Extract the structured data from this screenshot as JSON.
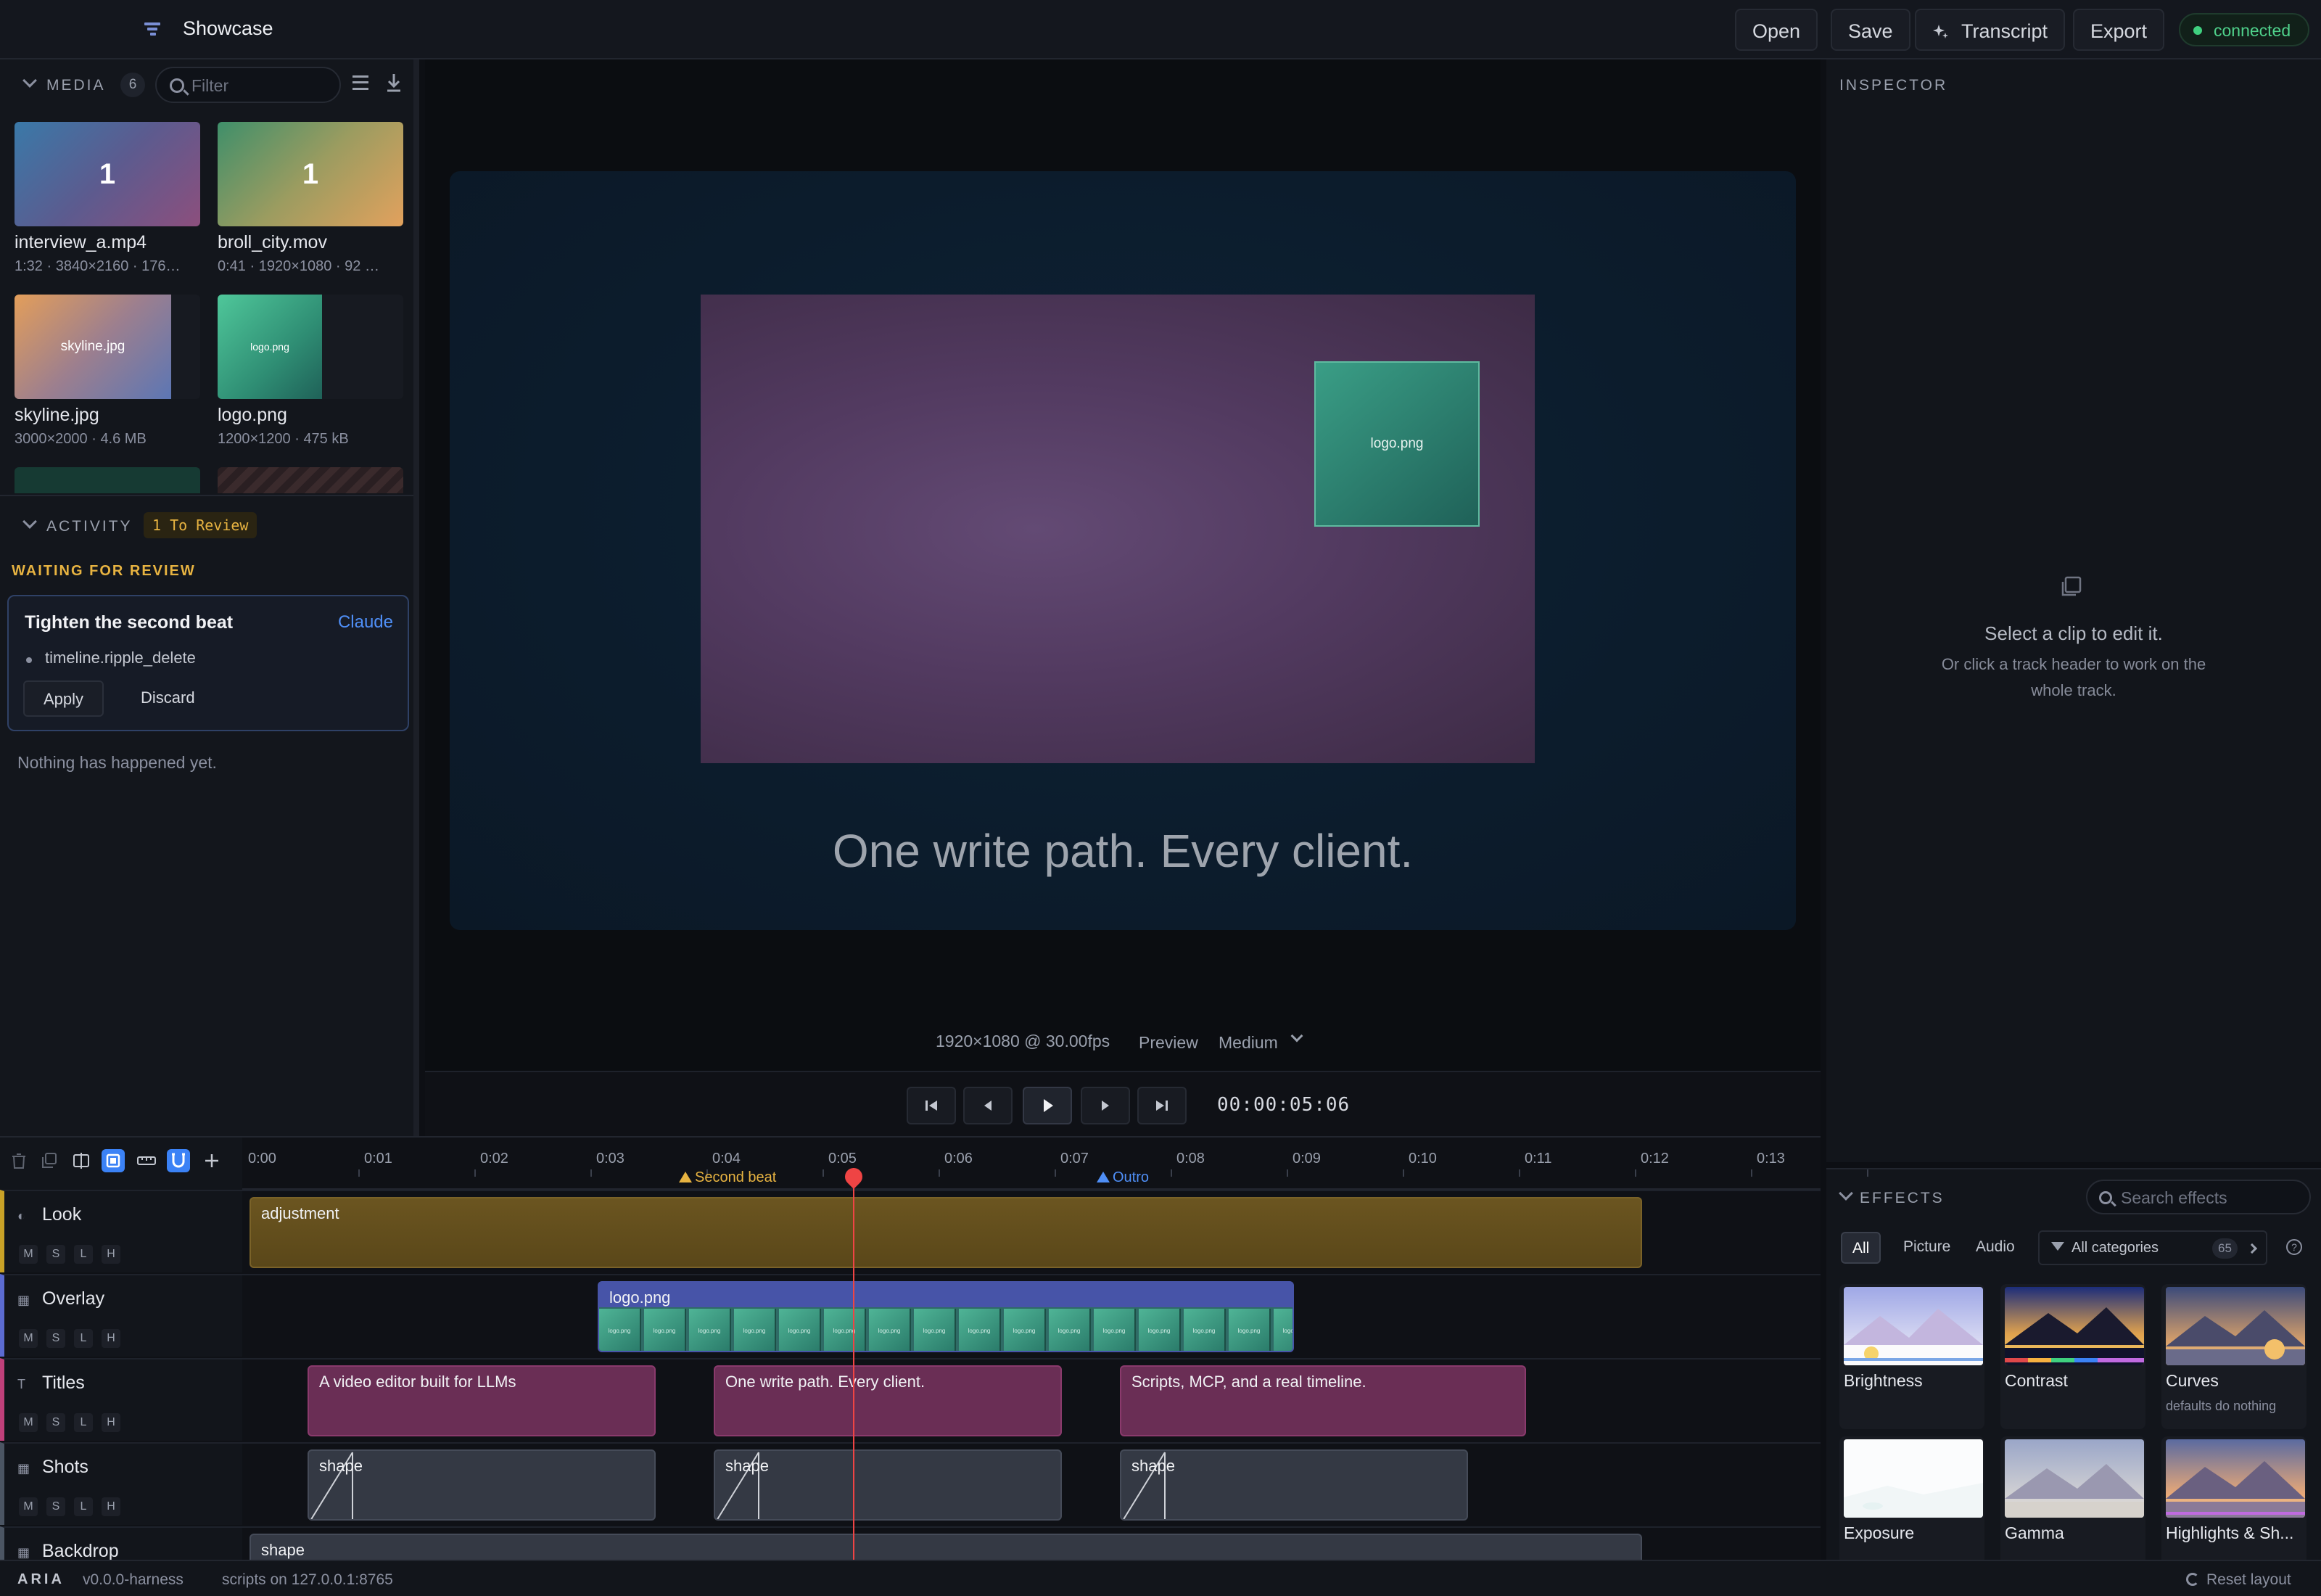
{
  "app": {
    "title": "Showcase"
  },
  "toolbar": {
    "open": "Open",
    "save": "Save",
    "transcript": "Transcript",
    "export": "Export",
    "status": "connected"
  },
  "media": {
    "title": "MEDIA",
    "count": "6",
    "filter_placeholder": "Filter",
    "items": [
      {
        "name": "interview_a.mp4",
        "meta": "1:32 · 3840×2160 · 176…",
        "thumb_text": "1"
      },
      {
        "name": "broll_city.mov",
        "meta": "0:41 · 1920×1080 · 92 …",
        "thumb_text": "1"
      },
      {
        "name": "skyline.jpg",
        "meta": "3000×2000 · 4.6 MB",
        "thumb_text": "skyline.jpg"
      },
      {
        "name": "logo.png",
        "meta": "1200×1200 · 475 kB",
        "thumb_text": "logo.png"
      }
    ]
  },
  "activity": {
    "title": "ACTIVITY",
    "badge": "1 To Review",
    "waiting": "WAITING FOR REVIEW",
    "card": {
      "title": "Tighten the second beat",
      "agent": "Claude",
      "op": "timeline.ripple_delete",
      "apply": "Apply",
      "discard": "Discard"
    },
    "empty": "Nothing has happened yet."
  },
  "viewer": {
    "overlay_label": "logo.png",
    "caption": "One write path. Every client.",
    "meta": "1920×1080 @ 30.00fps",
    "preview": "Preview",
    "quality": "Medium",
    "timecode": "00:00:05:06"
  },
  "inspector": {
    "title": "INSPECTOR",
    "message": "Select a clip to edit it.",
    "hint": "Or click a track header to work on the whole track."
  },
  "effects": {
    "title": "EFFECTS",
    "search_placeholder": "Search effects",
    "tabs": [
      "All",
      "Picture",
      "Audio"
    ],
    "category": "All categories",
    "category_count": "65",
    "help": "?",
    "items": [
      {
        "name": "Brightness",
        "sub": ""
      },
      {
        "name": "Contrast",
        "sub": ""
      },
      {
        "name": "Curves",
        "sub": "defaults do nothing"
      },
      {
        "name": "Exposure",
        "sub": ""
      },
      {
        "name": "Gamma",
        "sub": ""
      },
      {
        "name": "Highlights & Sh...",
        "sub": ""
      }
    ]
  },
  "timeline": {
    "ticks": [
      "0:00",
      "0:01",
      "0:02",
      "0:03",
      "0:04",
      "0:05",
      "0:06",
      "0:07",
      "0:08",
      "0:09",
      "0:10",
      "0:11",
      "0:12",
      "0:13"
    ],
    "markers": [
      {
        "label": "Second beat",
        "time": 3.7
      },
      {
        "label": "Outro",
        "time": 7.3
      }
    ],
    "playhead_time": 5.2,
    "mslh": [
      "M",
      "S",
      "L",
      "H"
    ],
    "tracks": [
      {
        "name": "Look",
        "glyph": "◐",
        "accent": "#c9a227"
      },
      {
        "name": "Overlay",
        "glyph": "▦",
        "accent": "#5b6bd1"
      },
      {
        "name": "Titles",
        "glyph": "T",
        "accent": "#c0407a"
      },
      {
        "name": "Shots",
        "glyph": "▦",
        "accent": "#4b5563"
      },
      {
        "name": "Backdrop",
        "glyph": "▦",
        "accent": "#4b5563"
      }
    ],
    "clips": {
      "look": [
        {
          "label": "adjustment",
          "start": 0,
          "end": 12.0
        }
      ],
      "overlay": [
        {
          "label": "logo.png",
          "start": 3.0,
          "end": 9.0,
          "frame_label": "logo.png"
        }
      ],
      "titles": [
        {
          "label": "A video editor built for LLMs",
          "start": 0.5,
          "end": 3.5
        },
        {
          "label": "One write path. Every client.",
          "start": 4.0,
          "end": 7.0
        },
        {
          "label": "Scripts, MCP, and a real timeline.",
          "start": 7.5,
          "end": 11.0
        }
      ],
      "shots": [
        {
          "label": "shape",
          "start": 0.5,
          "end": 3.5
        },
        {
          "label": "shape",
          "start": 4.0,
          "end": 7.0
        },
        {
          "label": "shape",
          "start": 7.5,
          "end": 10.5
        }
      ],
      "backdrop": [
        {
          "label": "shape",
          "start": 0,
          "end": 12.0
        }
      ]
    }
  },
  "footer": {
    "brand": "ARIA",
    "version": "v0.0.0-harness",
    "scripts": "scripts on 127.0.0.1:8765",
    "reset": "Reset layout"
  }
}
